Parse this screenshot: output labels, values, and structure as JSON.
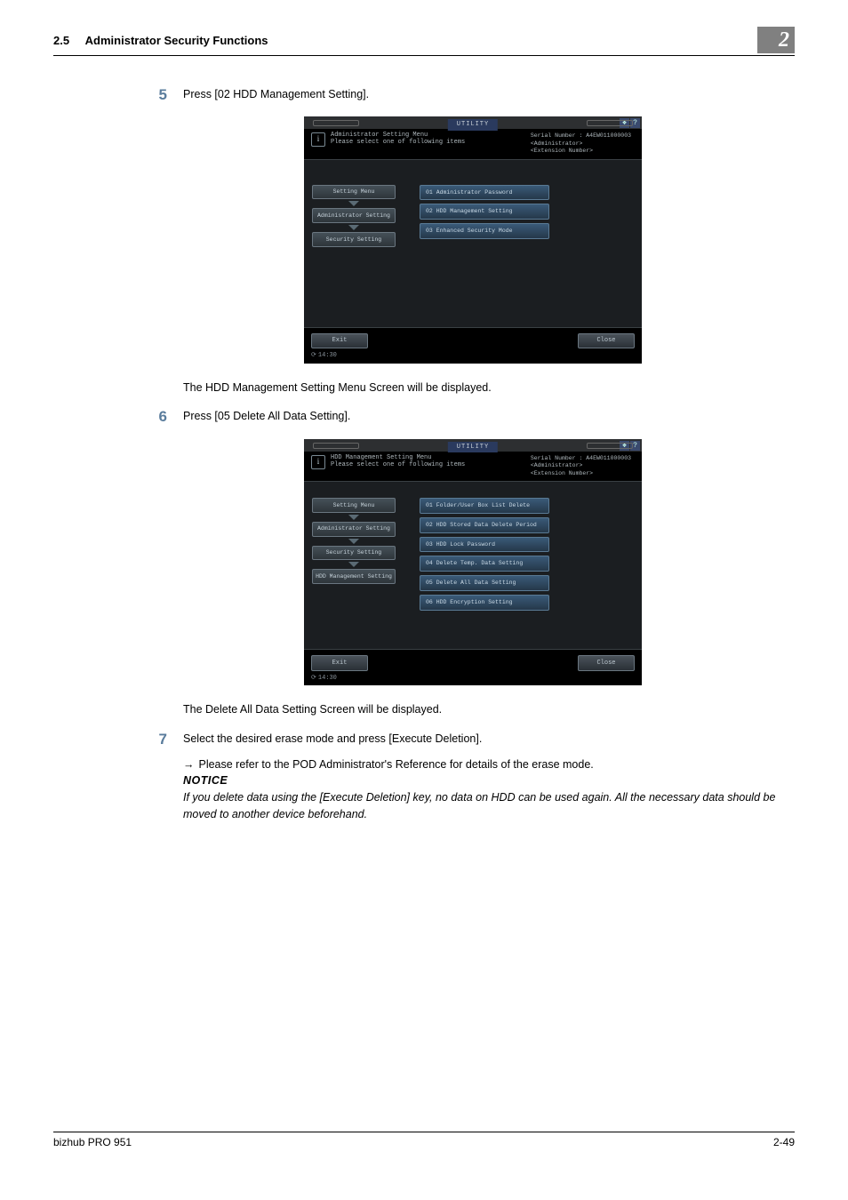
{
  "header": {
    "section": "2.5",
    "title": "Administrator Security Functions",
    "chapter": "2"
  },
  "step5": {
    "num": "5",
    "text": "Press [02 HDD Management Setting].",
    "after": "The HDD Management Setting Menu Screen will be displayed."
  },
  "step6": {
    "num": "6",
    "text": "Press [05 Delete All Data Setting].",
    "after": "The Delete All Data Setting Screen will be displayed."
  },
  "step7": {
    "num": "7",
    "text": "Select the desired erase mode and press [Execute Deletion].",
    "sub_arrow": "→",
    "sub": "Please refer to the POD Administrator's Reference for details of the erase mode.",
    "notice_label": "NOTICE",
    "notice_text": "If you delete data using the [Execute Deletion] key, no data on HDD can be used again. All the necessary data should be moved to another device beforehand."
  },
  "shot_common": {
    "utility": "UTILITY",
    "serial_label": "Serial Number",
    "serial_value": "A4EW011000003",
    "admin_line": "<Administrator>",
    "ext_line": "<Extension Number>",
    "exit": "Exit",
    "close": "Close",
    "clock": "14:30",
    "info_icon": "i"
  },
  "shot1": {
    "title_l1": "Administrator Setting Menu",
    "title_l2": "Please select one of following items",
    "breadcrumb": [
      "Setting Menu",
      "Administrator Setting",
      "Security Setting"
    ],
    "options": [
      "01 Administrator Password",
      "02 HDD Management Setting",
      "03 Enhanced Security Mode"
    ]
  },
  "shot2": {
    "title_l1": "HDD Management Setting Menu",
    "title_l2": "Please select one of following items",
    "breadcrumb": [
      "Setting Menu",
      "Administrator Setting",
      "Security Setting",
      "HDD Management Setting"
    ],
    "options": [
      "01 Folder/User Box List Delete",
      "02 HDD Stored Data Delete Period",
      "03 HDD Lock Password",
      "04 Delete Temp. Data Setting",
      "05 Delete All Data Setting",
      "06 HDD Encryption Setting"
    ]
  },
  "footer": {
    "left": "bizhub PRO 951",
    "right": "2-49"
  }
}
